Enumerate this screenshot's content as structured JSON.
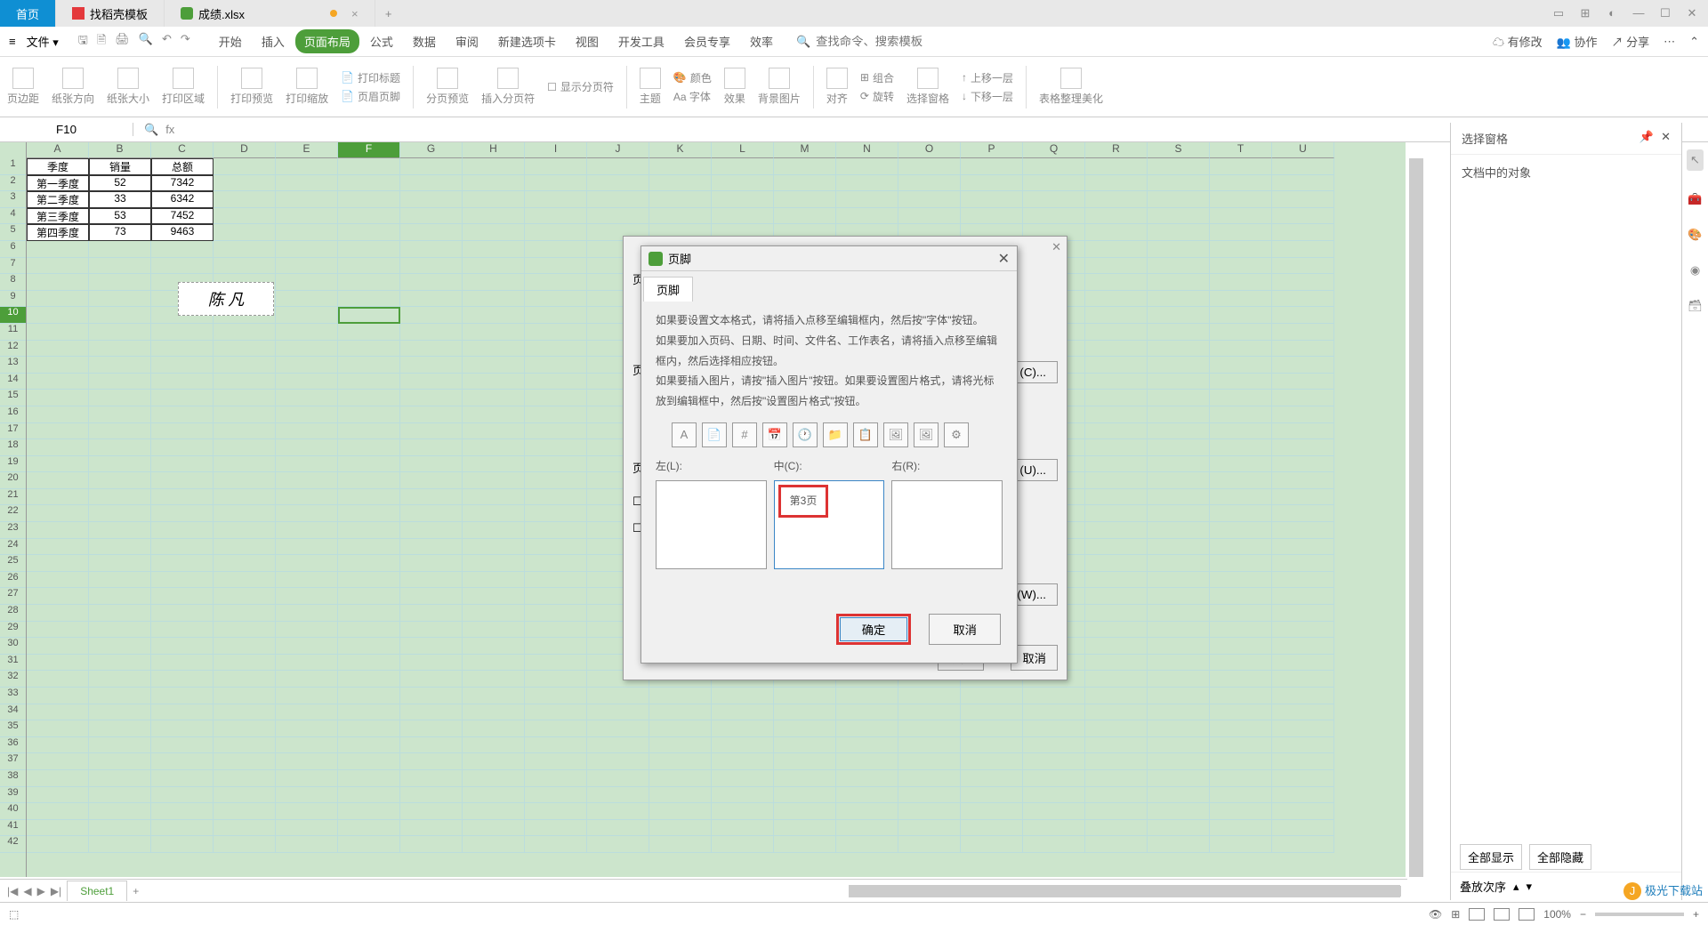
{
  "titlebar": {
    "tabs": [
      {
        "label": "首页"
      },
      {
        "label": "找稻壳模板"
      },
      {
        "label": "成绩.xlsx"
      }
    ]
  },
  "menu": {
    "file": "文件",
    "tabs": [
      "开始",
      "插入",
      "页面布局",
      "公式",
      "数据",
      "审阅",
      "新建选项卡",
      "视图",
      "开发工具",
      "会员专享",
      "效率"
    ],
    "active_tab": "页面布局",
    "search_placeholder": "查找命令、搜索模板",
    "right": [
      "有修改",
      "协作",
      "分享"
    ]
  },
  "ribbon": {
    "items": [
      "页边距",
      "纸张方向",
      "纸张大小",
      "打印区域",
      "打印预览",
      "打印缩放",
      "打印标题",
      "页眉页脚",
      "分页预览",
      "插入分页符",
      "显示分页符",
      "主题",
      "颜色",
      "Aa 字体",
      "效果",
      "背景图片",
      "对齐",
      "组合",
      "旋转",
      "选择窗格",
      "上移一层",
      "下移一层",
      "表格整理美化"
    ]
  },
  "namebox": {
    "value": "F10"
  },
  "columns": [
    "A",
    "B",
    "C",
    "D",
    "E",
    "F",
    "G",
    "H",
    "I",
    "J",
    "K",
    "L",
    "M",
    "N",
    "O",
    "P",
    "Q",
    "R",
    "S",
    "T",
    "U"
  ],
  "data": {
    "header": [
      "季度",
      "销量",
      "总额"
    ],
    "rows": [
      [
        "第一季度",
        "52",
        "7342"
      ],
      [
        "第二季度",
        "33",
        "6342"
      ],
      [
        "第三季度",
        "53",
        "7452"
      ],
      [
        "第四季度",
        "73",
        "9463"
      ]
    ]
  },
  "signature": "陈 凡",
  "rightpanel": {
    "title": "选择窗格",
    "subtitle": "文档中的对象",
    "stack_label": "叠放次序",
    "show_all": "全部显示",
    "hide_all": "全部隐藏"
  },
  "dialog_back": {
    "btn_c": "(C)...",
    "btn_u": "(U)...",
    "btn_w": "(W)...",
    "ok": "确定",
    "cancel": "取消"
  },
  "dialog": {
    "title": "页脚",
    "tab": "页脚",
    "instructions": [
      "如果要设置文本格式，请将插入点移至编辑框内，然后按\"字体\"按钮。",
      "如果要加入页码、日期、时间、文件名、工作表名，请将插入点移至编辑框内，然后选择相应按钮。",
      "如果要插入图片，请按\"插入图片\"按钮。如果要设置图片格式，请将光标放到编辑框中，然后按\"设置图片格式\"按钮。"
    ],
    "icon_tips": [
      "A",
      "📄",
      "#",
      "📅",
      "🕐",
      "📁",
      "📋",
      "🖼",
      "🖼",
      "⚙"
    ],
    "sections": {
      "left": "左(L):",
      "center": "中(C):",
      "right": "右(R):",
      "center_value": "第3页"
    },
    "ok": "确定",
    "cancel": "取消"
  },
  "sheettabs": {
    "sheet1": "Sheet1"
  },
  "statusbar": {
    "zoom": "100%"
  },
  "watermark": "极光下载站"
}
